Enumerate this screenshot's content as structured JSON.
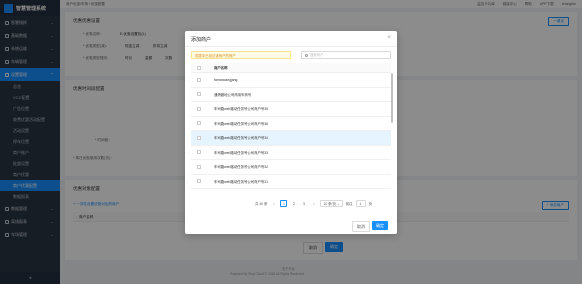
{
  "app": {
    "title": "智慧管理系统"
  },
  "sidebar": {
    "items": [
      {
        "label": "智慧指挥"
      },
      {
        "label": "基础数据"
      },
      {
        "label": "系统运维"
      },
      {
        "label": "车辆管理"
      },
      {
        "label": "设置管理"
      }
    ],
    "sub_items": [
      "总览",
      "VCC配置",
      "广告位置",
      "收费优惠活动配置",
      "活动设置",
      "停车位置",
      "商户账户",
      "批量设置",
      "商户优惠",
      "商户优惠配置",
      "数据报表"
    ],
    "bottom_items": [
      {
        "label": "数据管理"
      },
      {
        "label": "离线报表"
      },
      {
        "label": "车场管理"
      }
    ]
  },
  "topbar": {
    "breadcrumb": "商户优惠/车场 / 优惠配置",
    "right": [
      "监控卡片库",
      "链接中心",
      "帮助",
      "APP下载",
      "zhangbin"
    ]
  },
  "background": {
    "section1": "优惠优惠设置",
    "lbl_name": "* 优惠名称：",
    "val_name": "E.优惠设置包(1)",
    "lbl_type": "* 优惠类型(减)：",
    "opt_type1": "现金立减",
    "opt_type2": "折扣立减",
    "lbl_charge": "* 优惠类型规则：",
    "opt_c1": "时长",
    "opt_c2": "金额",
    "opt_c3": "次数",
    "section2": "优惠时间段配置",
    "lbl_period": "* 时间段：",
    "lbl_limit": "* 单日优惠使用次数(次)：",
    "section3": "优惠对象配置",
    "add_merchant_link": "+ 一次性设置优惠对应的商户",
    "add_btn": "+ 添加商户",
    "col_merchant": "商户名称",
    "cancel": "取消",
    "save": "确定",
    "right_btn": "一键设",
    "footer1": "关于平台",
    "footer2": "Powered By Stop Cloud © 2018 All Rights Reserved"
  },
  "modal": {
    "title": "添加商户",
    "warning": "同类中已设过该商户的商户",
    "search_placeholder": "搜索商户",
    "column": "商户名称",
    "rows": [
      "fanrancangjang",
      "通滑副地公司商用车商号",
      "车司路web路动任务号公司商户号35",
      "车司路web路动任务号公司商户号36",
      "车司路web路动任务号公司商户号34",
      "车司路web路动任务号公司商户号33",
      "车司路web路动任务号公司商户号32",
      "车司路web路动任务号公司商户号31"
    ],
    "pager": {
      "total": "共 40 条",
      "prev": "‹",
      "next": "›",
      "pages": [
        "1",
        "2",
        "3"
      ],
      "page_size": "10 条/页",
      "goto_label": "前往",
      "goto_value": "1",
      "page_unit": "页"
    },
    "cancel": "取消",
    "ok": "确定"
  }
}
